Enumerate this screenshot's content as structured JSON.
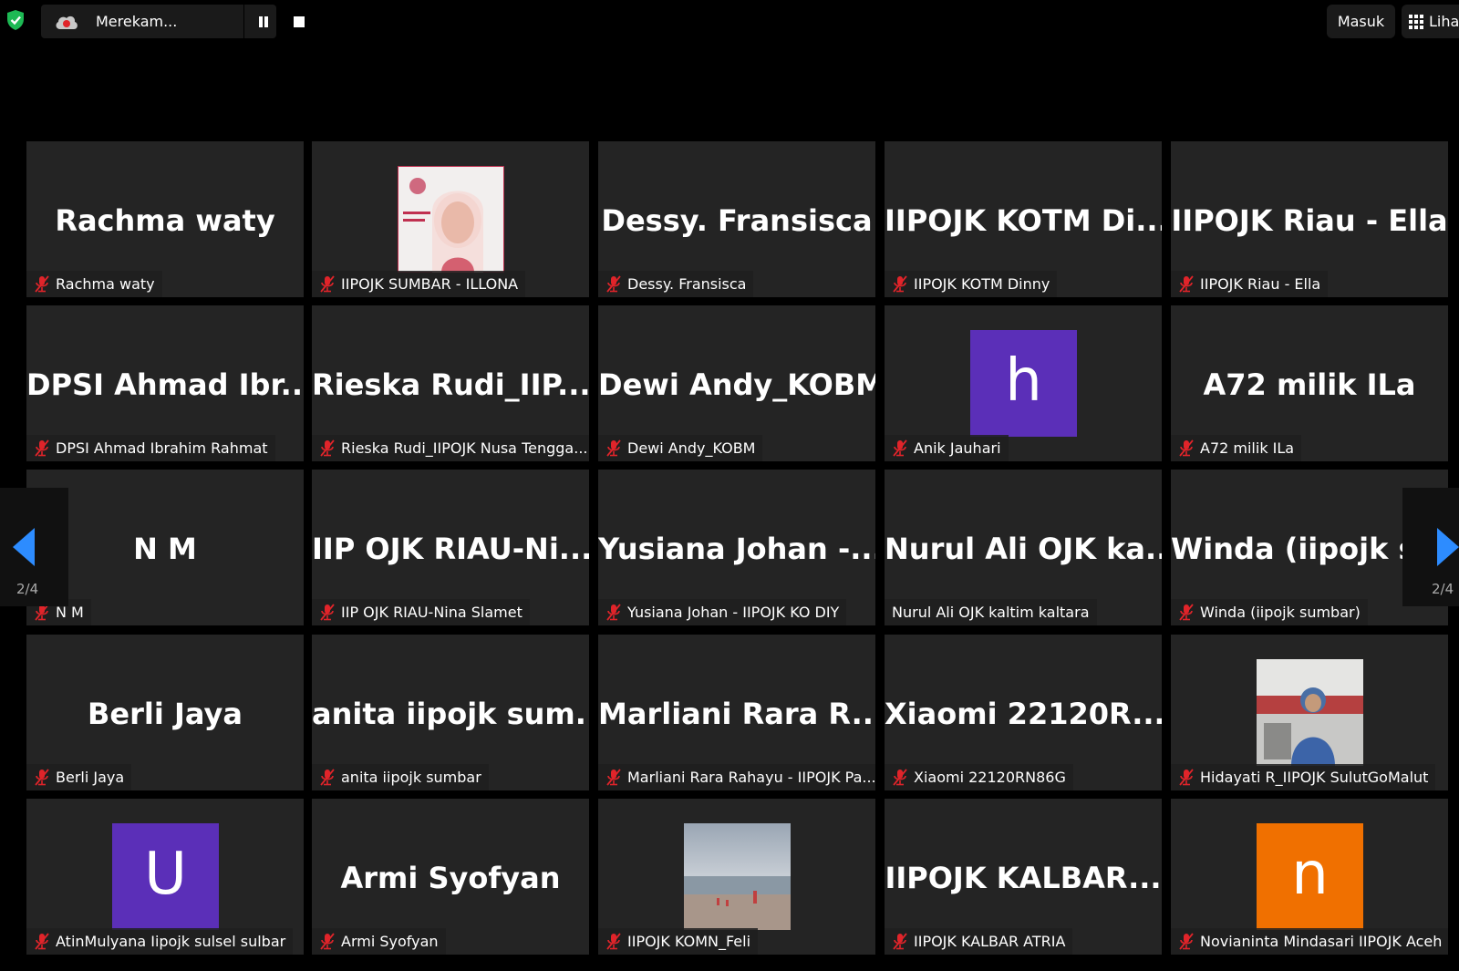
{
  "topbar": {
    "recording_label": "Merekam...",
    "signin_label": "Masuk",
    "view_label": "Lihat",
    "shield_color": "#1db954"
  },
  "nav": {
    "page_indicator_left": "2/4",
    "page_indicator_right": "2/4",
    "arrow_color": "#2d8cff"
  },
  "tiles": [
    {
      "display": "Rachma waty",
      "tag": "Rachma waty",
      "muted": true
    },
    {
      "display": "",
      "tag": "IIPOJK SUMBAR - ILLONA",
      "muted": true,
      "photo": "pink-portrait"
    },
    {
      "display": "Dessy. Fransisca",
      "tag": "Dessy. Fransisca",
      "muted": true
    },
    {
      "display": "IIPOJK KOTM Di...",
      "tag": "IIPOJK KOTM Dinny",
      "muted": true
    },
    {
      "display": "IIPOJK Riau - Ella",
      "tag": "IIPOJK Riau - Ella",
      "muted": true
    },
    {
      "display": "DPSI Ahmad Ibr...",
      "tag": "DPSI Ahmad Ibrahim Rahmat",
      "muted": true
    },
    {
      "display": "Rieska Rudi_IIP...",
      "tag": "Rieska Rudi_IIPOJK Nusa Tengga...",
      "muted": true
    },
    {
      "display": "Dewi Andy_KOBM",
      "tag": "Dewi Andy_KOBM",
      "muted": true
    },
    {
      "display": "",
      "tag": "Anik Jauhari",
      "muted": true,
      "letter": "h",
      "letter_bg": "#5b2fb8"
    },
    {
      "display": "A72 milik ILa",
      "tag": "A72 milik ILa",
      "muted": true
    },
    {
      "display": "N M",
      "tag": "N M",
      "muted": true
    },
    {
      "display": "IIP OJK RIAU-Ni...",
      "tag": "IIP OJK RIAU-Nina Slamet",
      "muted": true
    },
    {
      "display": "Yusiana Johan -...",
      "tag": "Yusiana Johan - IIPOJK KO DIY",
      "muted": true
    },
    {
      "display": "Nurul Ali OJK ka...",
      "tag": "Nurul Ali OJK kaltim kaltara",
      "muted": false
    },
    {
      "display": "Winda (iipojk sumbar)",
      "tag": "Winda (iipojk sumbar)",
      "muted": true
    },
    {
      "display": "Berli Jaya",
      "tag": "Berli Jaya",
      "muted": true
    },
    {
      "display": "anita iipojk sum...",
      "tag": "anita iipojk sumbar",
      "muted": true
    },
    {
      "display": "Marliani Rara R...",
      "tag": "Marliani Rara Rahayu - IIPOJK Pa...",
      "muted": true
    },
    {
      "display": "Xiaomi 22120R...",
      "tag": "Xiaomi 22120RN86G",
      "muted": true
    },
    {
      "display": "",
      "tag": "Hidayati R_IIPOJK SulutGoMalut",
      "muted": true,
      "photo": "office-portrait"
    },
    {
      "display": "",
      "tag": "AtinMulyana Iipojk sulsel sulbar",
      "muted": true,
      "letter": "U",
      "letter_bg": "#5b2fb8"
    },
    {
      "display": "Armi Syofyan",
      "tag": "Armi Syofyan",
      "muted": true
    },
    {
      "display": "",
      "tag": "IIPOJK KOMN_Feli",
      "muted": true,
      "photo": "beach"
    },
    {
      "display": "IIPOJK KALBAR...",
      "tag": "IIPOJK KALBAR ATRIA",
      "muted": true
    },
    {
      "display": "",
      "tag": "Novianinta Mindasari IIPOJK Aceh",
      "muted": true,
      "letter": "n",
      "letter_bg": "#f07000"
    }
  ]
}
